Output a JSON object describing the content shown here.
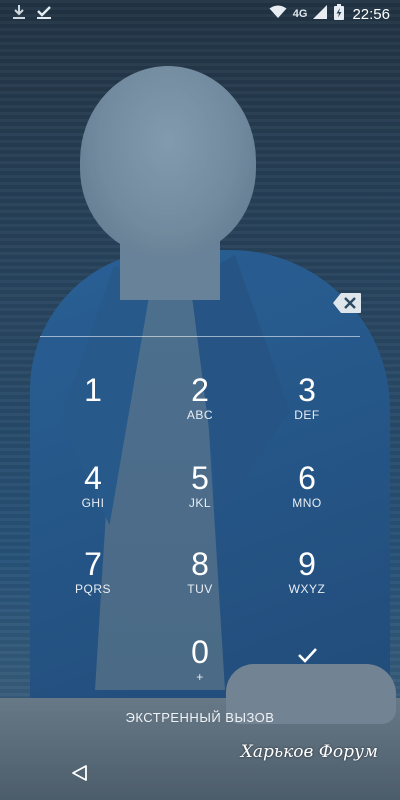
{
  "status_bar": {
    "network_type": "4G",
    "time": "22:56",
    "icons": [
      "download-icon",
      "checkmark-icon",
      "wifi-icon",
      "signal-icon",
      "battery-charging-icon"
    ]
  },
  "keypad": {
    "keys": [
      {
        "number": "1",
        "letters": ""
      },
      {
        "number": "2",
        "letters": "ABC"
      },
      {
        "number": "3",
        "letters": "DEF"
      },
      {
        "number": "4",
        "letters": "GHI"
      },
      {
        "number": "5",
        "letters": "JKL"
      },
      {
        "number": "6",
        "letters": "MNO"
      },
      {
        "number": "7",
        "letters": "PQRS"
      },
      {
        "number": "8",
        "letters": "TUV"
      },
      {
        "number": "9",
        "letters": "WXYZ"
      },
      {
        "number": "0",
        "letters": "+"
      }
    ],
    "icons": [
      "backspace-icon",
      "checkmark-icon"
    ]
  },
  "emergency_call": "ЭКСТРЕННЫЙ ВЫЗОВ",
  "watermark": "Харьков Форум",
  "nav": {
    "icons": [
      "back-icon"
    ]
  }
}
